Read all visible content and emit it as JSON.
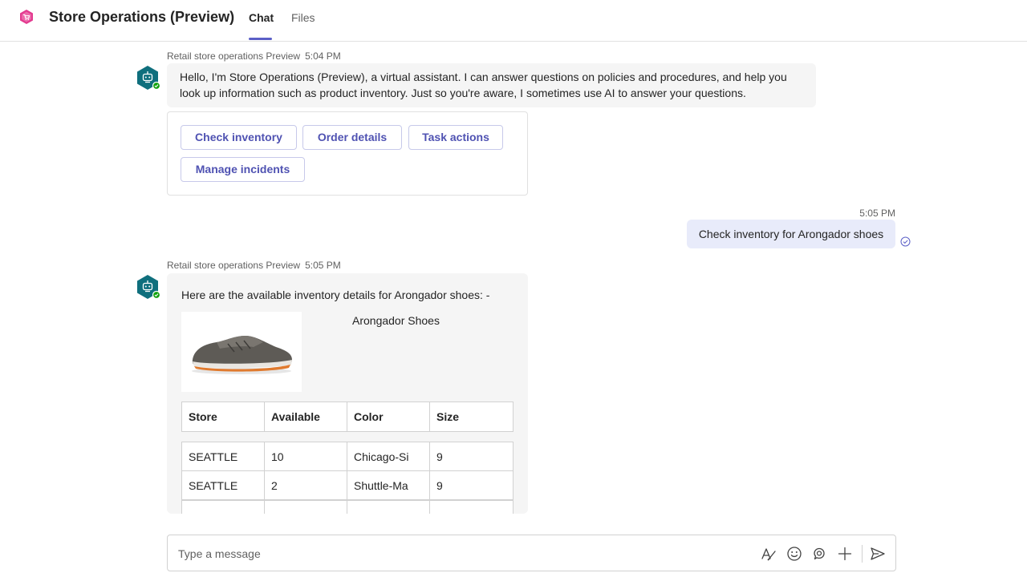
{
  "app": {
    "title": "Store Operations (Preview)",
    "tabs": [
      {
        "label": "Chat",
        "active": true
      },
      {
        "label": "Files",
        "active": false
      }
    ],
    "accent_color": "#5b5fc7",
    "logo_color": "#e3398f"
  },
  "messages": {
    "bot1": {
      "sender": "Retail store operations Preview",
      "time": "5:04 PM",
      "text": "Hello, I'm Store Operations (Preview), a virtual assistant. I can answer questions on policies and procedures, and help you look up information such as product inventory. Just so you're aware, I sometimes use AI to answer your questions.",
      "buttons": [
        "Check inventory",
        "Order details",
        "Task actions",
        "Manage incidents"
      ]
    },
    "user1": {
      "time": "5:05 PM",
      "text": "Check inventory for Arongador shoes",
      "status_icon": "read-check-icon"
    },
    "bot2": {
      "sender": "Retail store operations Preview",
      "time": "5:05 PM",
      "intro": "Here are the available inventory details for Arongador shoes: -",
      "product_title": "Arongador Shoes",
      "table": {
        "headers": [
          "Store",
          "Available",
          "Color",
          "Size"
        ],
        "rows": [
          [
            "SEATTLE",
            "10",
            "Chicago-Si",
            "9"
          ],
          [
            "SEATTLE",
            "2",
            "Shuttle-Ma",
            "9"
          ],
          [
            "",
            "",
            "",
            ""
          ]
        ]
      }
    }
  },
  "compose": {
    "placeholder": "Type a message",
    "icons": [
      "format-icon",
      "emoji-icon",
      "loop-icon",
      "attach-plus-icon",
      "send-icon"
    ]
  }
}
